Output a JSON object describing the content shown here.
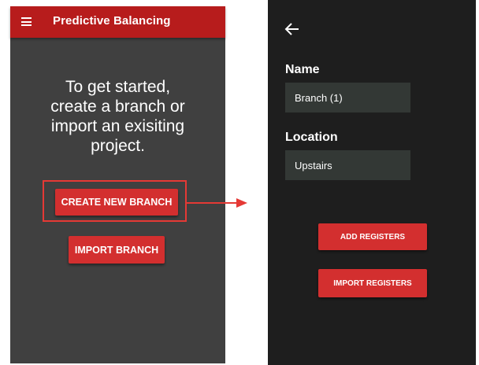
{
  "left_screen": {
    "appbar": {
      "menu_icon": "hamburger-menu-icon",
      "title": "Predictive Balancing",
      "color": "#b71c1c"
    },
    "intro_lines": [
      "To get started,",
      "create a branch or",
      "import an exisiting",
      "project."
    ],
    "create_button_label": "CREATE NEW BRANCH",
    "import_button_label": "IMPORT BRANCH",
    "background": "#404040"
  },
  "annotation": {
    "highlight_color": "#e53935",
    "arrow_icon": "arrow-right-icon"
  },
  "right_screen": {
    "back_icon": "arrow-back-icon",
    "name_label": "Name",
    "name_value": "Branch (1)",
    "location_label": "Location",
    "location_value": "Upstairs",
    "add_registers_label": "ADD REGISTERS",
    "import_registers_label": "IMPORT REGISTERS",
    "background": "#1e1e1e"
  },
  "accent_color": "#d32f2f"
}
